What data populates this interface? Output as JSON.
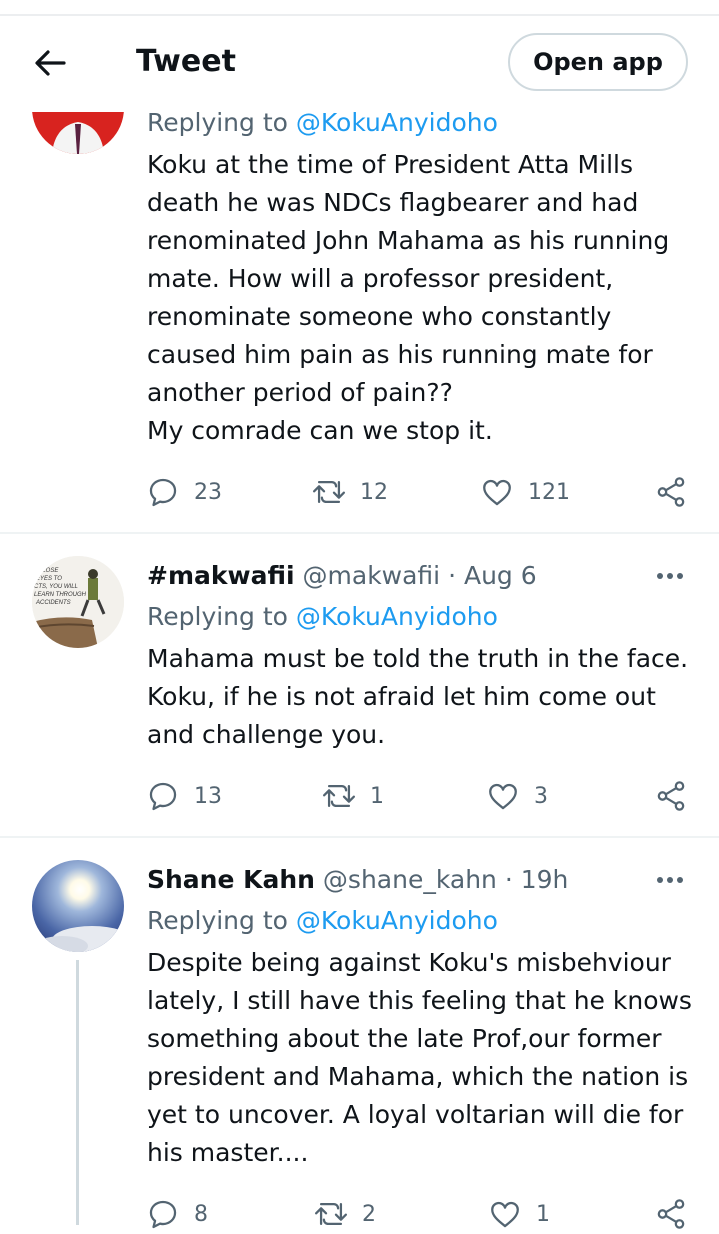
{
  "header": {
    "title": "Tweet",
    "open_app": "Open app"
  },
  "tweets": [
    {
      "replying_prefix": "Replying to ",
      "replying_handle": "@KokuAnyidoho",
      "body": "Koku at the time of President Atta Mills\ndeath he was NDCs flagbearer and had\nrenominated John Mahama as his running\nmate. How will a professor president,\nrenominate someone who constantly\ncaused him pain as his running mate for\nanother period of pain??\nMy comrade can we stop it.",
      "replies": "23",
      "retweets": "12",
      "likes": "121"
    },
    {
      "name": "#makwafii",
      "handle": "@makwafii",
      "time": " · Aug 6",
      "avatar_text": "CLOSE\nEYES TO\nCTS, YOU WILL\nLEARN THROUGH\nACCIDENTS",
      "replying_prefix": "Replying to ",
      "replying_handle": "@KokuAnyidoho",
      "body": "Mahama must be told the truth in the face.\nKoku, if he is not afraid let him come out\nand challenge you.",
      "replies": "13",
      "retweets": "1",
      "likes": "3"
    },
    {
      "name": "Shane Kahn",
      "handle": "@shane_kahn",
      "time": " · 19h",
      "replying_prefix": "Replying to ",
      "replying_handle": "@KokuAnyidoho",
      "body": "Despite being against Koku's misbehviour\nlately, I still have this feeling that he knows\nsomething about the late Prof,our former\npresident and Mahama, which the nation is\nyet to uncover. A loyal voltarian will die for\nhis master....",
      "replies": "8",
      "retweets": "2",
      "likes": "1"
    }
  ],
  "colors": {
    "link": "#1d9bf0",
    "muted": "#536471",
    "text": "#0f1419"
  },
  "icons": [
    "back-arrow-icon",
    "reply-icon",
    "retweet-icon",
    "like-icon",
    "share-icon",
    "more-icon"
  ]
}
